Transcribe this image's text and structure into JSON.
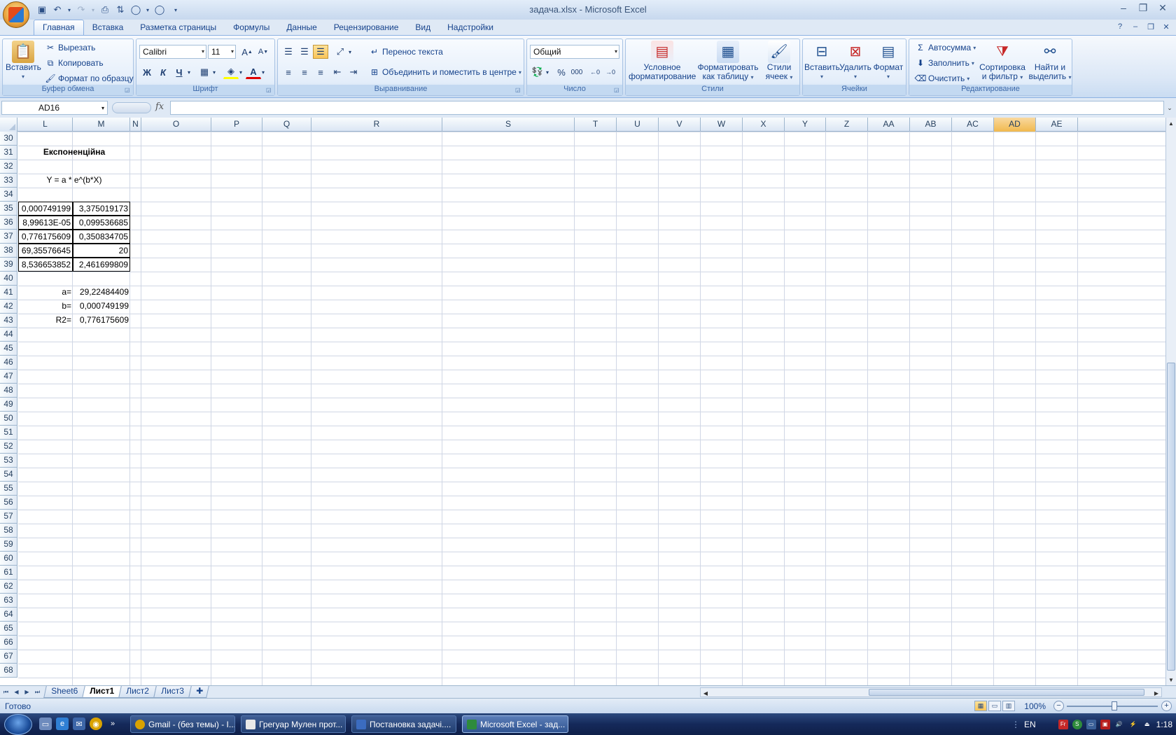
{
  "window": {
    "title": "задача.xlsx - Microsoft Excel"
  },
  "ribbon_tabs": [
    "Главная",
    "Вставка",
    "Разметка страницы",
    "Формулы",
    "Данные",
    "Рецензирование",
    "Вид",
    "Надстройки"
  ],
  "ribbon": {
    "clipboard": {
      "label": "Буфер обмена",
      "paste": "Вставить",
      "cut": "Вырезать",
      "copy": "Копировать",
      "format_painter": "Формат по образцу"
    },
    "font": {
      "label": "Шрифт",
      "name": "Calibri",
      "size": "11",
      "bold": "Ж",
      "italic": "К",
      "underline": "Ч"
    },
    "alignment": {
      "label": "Выравнивание",
      "wrap": "Перенос текста",
      "merge": "Объединить и поместить в центре"
    },
    "number": {
      "label": "Число",
      "format": "Общий"
    },
    "styles": {
      "label": "Стили",
      "conditional_l1": "Условное",
      "conditional_l2": "форматирование",
      "table_l1": "Форматировать",
      "table_l2": "как таблицу",
      "cell_l1": "Стили",
      "cell_l2": "ячеек"
    },
    "cells": {
      "label": "Ячейки",
      "insert": "Вставить",
      "delete": "Удалить",
      "format": "Формат"
    },
    "editing": {
      "label": "Редактирование",
      "autosum": "Автосумма",
      "fill": "Заполнить",
      "clear": "Очистить",
      "sort_l1": "Сортировка",
      "sort_l2": "и фильтр",
      "find_l1": "Найти и",
      "find_l2": "выделить"
    }
  },
  "formula_bar": {
    "name_box": "AD16",
    "fx": "fx",
    "formula": ""
  },
  "columns": [
    "L",
    "M",
    "N",
    "O",
    "P",
    "Q",
    "R",
    "S",
    "T",
    "U",
    "V",
    "W",
    "X",
    "Y",
    "Z",
    "AA",
    "AB",
    "AC",
    "AD",
    "AE"
  ],
  "selected_column": "AD",
  "rows": [
    "30",
    "31",
    "32",
    "33",
    "34",
    "35",
    "36",
    "37",
    "38",
    "39",
    "40",
    "41",
    "42",
    "43",
    "44",
    "45",
    "46",
    "47",
    "48",
    "49",
    "50",
    "51",
    "52",
    "53",
    "54",
    "55",
    "56",
    "57",
    "58",
    "59",
    "60",
    "61",
    "62",
    "63",
    "64",
    "65",
    "66",
    "67",
    "68"
  ],
  "cells": {
    "L31": "Експоненційна",
    "L33": "Y = a * e^(b*X)",
    "L35": "0,000749199",
    "M35": "3,375019173",
    "L36": "8,99613E-05",
    "M36": "0,099536685",
    "L37": "0,776175609",
    "M37": "0,350834705",
    "L38": "69,35576645",
    "M38": "20",
    "L39": "8,536653852",
    "M39": "2,461699809",
    "L41": "a=",
    "M41": "29,22484409",
    "L42": "b=",
    "M42": "0,000749199",
    "L43": "R2=",
    "M43": "0,776175609"
  },
  "sheets": [
    "Sheet6",
    "Лист1",
    "Лист2",
    "Лист3"
  ],
  "active_sheet": "Лист1",
  "status": {
    "text": "Готово",
    "zoom": "100%"
  },
  "taskbar": {
    "tasks": [
      "Gmail - (без темы) - I...",
      "Грегуар Мулен прот...",
      "Постановка задачі....",
      "Microsoft Excel - зад..."
    ],
    "language": "EN",
    "clock": "1:18"
  }
}
